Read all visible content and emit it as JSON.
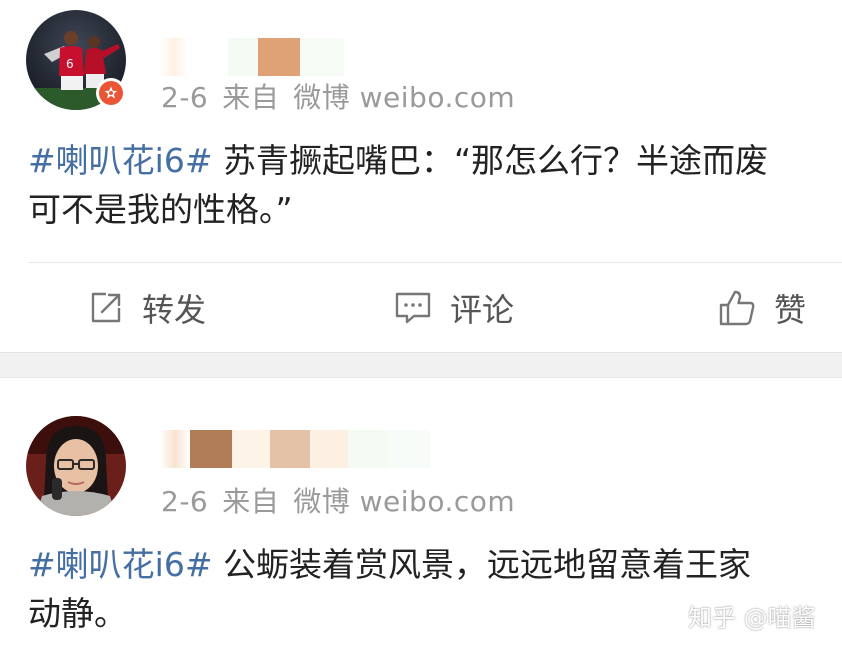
{
  "posts": [
    {
      "meta_time": "2-6",
      "meta_from": "来自",
      "meta_source": "微博 weibo.com",
      "hashtag": "#喇叭花i6#",
      "text_line1": " 苏青撅起嘴巴：“那怎么行？半途而废",
      "text_line2": "可不是我的性格。”",
      "verified": true
    },
    {
      "meta_time": "2-6",
      "meta_from": "来自",
      "meta_source": "微博 weibo.com",
      "hashtag": "#喇叭花i6#",
      "text_line1": " 公蛎装着赏风景，远远地留意着王家",
      "text_line2": "动静。",
      "verified": false
    }
  ],
  "actions": {
    "forward_label": "转发",
    "comment_label": "评论",
    "like_label": "赞"
  },
  "watermark": "知乎 @喵酱",
  "colors": {
    "hashtag": "#456ea2",
    "body_text": "#222222",
    "meta_text": "#9a9a9a",
    "action_text": "#555555",
    "separator_band": "#f1f1f1",
    "verify_badge": "#ea5535"
  },
  "icons": {
    "forward": "share-forward-icon",
    "comment": "comment-bubble-icon",
    "like": "thumbs-up-icon",
    "verified": "verified-star-badge-icon"
  }
}
